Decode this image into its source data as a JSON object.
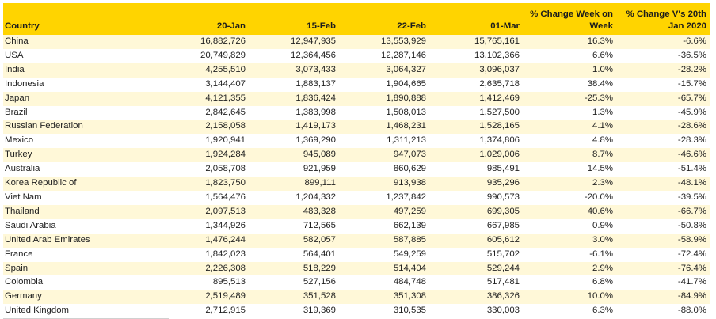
{
  "table": {
    "headers": [
      "Country",
      "20-Jan",
      "15-Feb",
      "22-Feb",
      "01-Mar",
      "% Change Week on Week",
      "% Change V's 20th Jan 2020"
    ],
    "header_lines": {
      "col5": [
        "% Change Week on",
        "Week"
      ],
      "col6": [
        "% Change V's 20th",
        "Jan 2020"
      ]
    },
    "rows": [
      [
        "China",
        "16,882,726",
        "12,947,935",
        "13,553,929",
        "15,765,161",
        "16.3%",
        "-6.6%"
      ],
      [
        "USA",
        "20,749,829",
        "12,364,456",
        "12,287,146",
        "13,102,366",
        "6.6%",
        "-36.5%"
      ],
      [
        "India",
        "4,255,510",
        "3,073,433",
        "3,064,327",
        "3,096,037",
        "1.0%",
        "-28.2%"
      ],
      [
        "Indonesia",
        "3,144,407",
        "1,883,137",
        "1,904,665",
        "2,635,718",
        "38.4%",
        "-15.7%"
      ],
      [
        "Japan",
        "4,121,355",
        "1,836,424",
        "1,890,888",
        "1,412,469",
        "-25.3%",
        "-65.7%"
      ],
      [
        "Brazil",
        "2,842,645",
        "1,383,998",
        "1,508,013",
        "1,527,500",
        "1.3%",
        "-45.9%"
      ],
      [
        "Russian Federation",
        "2,158,058",
        "1,419,173",
        "1,468,231",
        "1,528,165",
        "4.1%",
        "-28.6%"
      ],
      [
        "Mexico",
        "1,920,941",
        "1,369,290",
        "1,311,213",
        "1,374,806",
        "4.8%",
        "-28.3%"
      ],
      [
        "Turkey",
        "1,924,284",
        "945,089",
        "947,073",
        "1,029,006",
        "8.7%",
        "-46.6%"
      ],
      [
        "Australia",
        "2,058,708",
        "921,959",
        "860,629",
        "985,491",
        "14.5%",
        "-51.4%"
      ],
      [
        "Korea Republic of",
        "1,823,750",
        "899,111",
        "913,938",
        "935,296",
        "2.3%",
        "-48.1%"
      ],
      [
        "Viet Nam",
        "1,564,476",
        "1,204,332",
        "1,237,842",
        "990,573",
        "-20.0%",
        "-39.5%"
      ],
      [
        "Thailand",
        "2,097,513",
        "483,328",
        "497,259",
        "699,305",
        "40.6%",
        "-66.7%"
      ],
      [
        "Saudi Arabia",
        "1,344,926",
        "712,565",
        "662,139",
        "667,985",
        "0.9%",
        "-50.8%"
      ],
      [
        "United Arab Emirates",
        "1,476,244",
        "582,057",
        "587,885",
        "605,612",
        "3.0%",
        "-58.9%"
      ],
      [
        "France",
        "1,842,023",
        "564,401",
        "549,259",
        "515,702",
        "-6.1%",
        "-72.4%"
      ],
      [
        "Spain",
        "2,226,308",
        "518,229",
        "514,404",
        "529,244",
        "2.9%",
        "-76.4%"
      ],
      [
        "Colombia",
        "895,513",
        "527,156",
        "484,748",
        "517,481",
        "6.8%",
        "-41.7%"
      ],
      [
        "Germany",
        "2,519,489",
        "351,528",
        "351,308",
        "386,326",
        "10.0%",
        "-84.9%"
      ],
      [
        "United Kingdom",
        "2,712,915",
        "319,369",
        "310,535",
        "330,003",
        "6.3%",
        "-88.0%"
      ]
    ]
  },
  "colors": {
    "header_bg": "#ffd400",
    "odd_row_bg": "#fff8d8",
    "even_row_bg": "#ffffff"
  }
}
